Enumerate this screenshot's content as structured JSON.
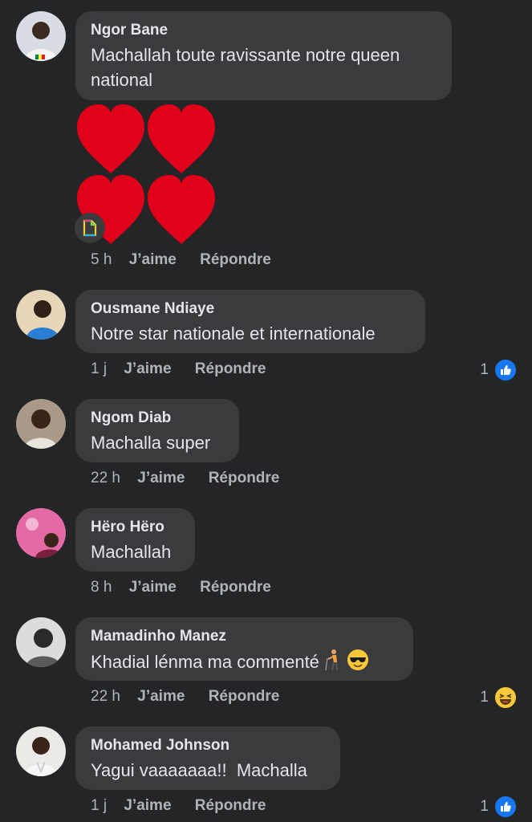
{
  "comments": [
    {
      "author": "Ngor Bane",
      "text": "Machallah toute ravissante notre queen national",
      "time": "5 h",
      "like_label": "J’aime",
      "reply_label": "Répondre",
      "attachment": "red-hearts-sticker",
      "reaction_count": "",
      "reaction_icon": ""
    },
    {
      "author": "Ousmane Ndiaye",
      "text": "Notre star nationale et internationale",
      "time": "1 j",
      "like_label": "J’aime",
      "reply_label": "Répondre",
      "reaction_count": "1",
      "reaction_icon": "like-icon"
    },
    {
      "author": "Ngom Diab",
      "text": "Machalla super",
      "time": "22 h",
      "like_label": "J’aime",
      "reply_label": "Répondre",
      "reaction_count": "",
      "reaction_icon": ""
    },
    {
      "author": "Hëro Hëro",
      "text": "Machallah",
      "time": "8 h",
      "like_label": "J’aime",
      "reply_label": "Répondre",
      "reaction_count": "",
      "reaction_icon": ""
    },
    {
      "author": "Mamadinho Manez",
      "text": "Khadial lénma ma commenté",
      "text_emojis": [
        "person-with-cane-emoji",
        "sunglasses-emoji"
      ],
      "time": "22 h",
      "like_label": "J’aime",
      "reply_label": "Répondre",
      "reaction_count": "1",
      "reaction_icon": "haha-icon"
    },
    {
      "author": "Mohamed Johnson",
      "text": "Yagui vaaaaaaa!!  Machalla",
      "time": "1 j",
      "like_label": "J’aime",
      "reply_label": "Répondre",
      "reaction_count": "1",
      "reaction_icon": "like-icon"
    }
  ],
  "colors": {
    "background": "#242526",
    "bubble": "#3a3b3c",
    "primary_text": "#e4e6eb",
    "secondary_text": "#b0b3b8",
    "like_blue": "#1877f2",
    "heart_red": "#e0001a"
  }
}
